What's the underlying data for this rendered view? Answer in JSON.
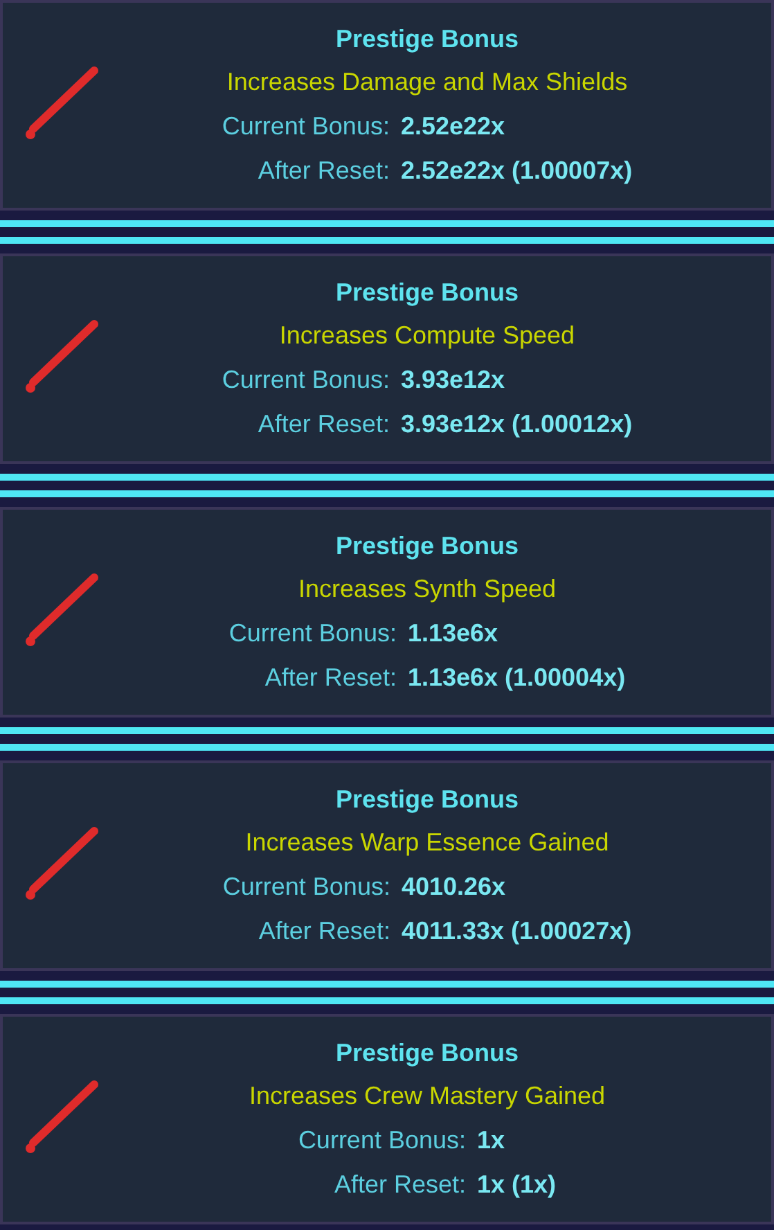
{
  "cards": [
    {
      "title": "Prestige Bonus",
      "description": "Increases Damage and Max Shields",
      "rows": [
        {
          "label": "Current Bonus:",
          "value": "2.52e22x"
        },
        {
          "label": "After Reset:",
          "value": "2.52e22x (1.00007x)"
        }
      ]
    },
    {
      "title": "Prestige Bonus",
      "description": "Increases Compute Speed",
      "rows": [
        {
          "label": "Current Bonus:",
          "value": "3.93e12x"
        },
        {
          "label": "After Reset:",
          "value": "3.93e12x (1.00012x)"
        }
      ]
    },
    {
      "title": "Prestige Bonus",
      "description": "Increases Synth Speed",
      "rows": [
        {
          "label": "Current Bonus:",
          "value": "1.13e6x"
        },
        {
          "label": "After Reset:",
          "value": "1.13e6x (1.00004x)"
        }
      ]
    },
    {
      "title": "Prestige Bonus",
      "description": "Increases Warp Essence Gained",
      "rows": [
        {
          "label": "Current Bonus:",
          "value": "4010.26x"
        },
        {
          "label": "After Reset:",
          "value": "4011.33x (1.00027x)"
        }
      ]
    },
    {
      "title": "Prestige Bonus",
      "description": "Increases Crew Mastery Gained",
      "rows": [
        {
          "label": "Current Bonus:",
          "value": "1x"
        },
        {
          "label": "After Reset:",
          "value": "1x (1x)"
        }
      ]
    }
  ]
}
